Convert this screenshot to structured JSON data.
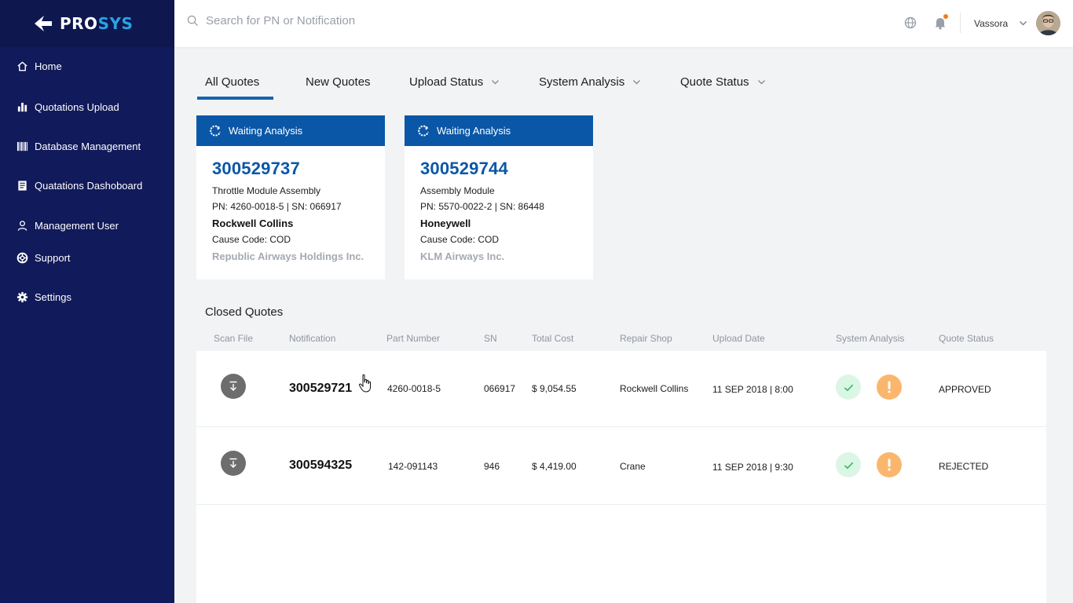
{
  "brand": {
    "name_part1": "PRO",
    "name_part2": "SYS"
  },
  "sidebar": {
    "items": [
      {
        "label": "Home",
        "icon": "home-icon"
      },
      {
        "label": "Quotations Upload",
        "icon": "bar-chart-icon"
      },
      {
        "label": "Database Management",
        "icon": "barcode-icon"
      },
      {
        "label": "Quatations Dashoboard",
        "icon": "document-icon"
      },
      {
        "label": "Management User",
        "icon": "user-icon"
      },
      {
        "label": "Support",
        "icon": "lifebuoy-icon"
      },
      {
        "label": "Settings",
        "icon": "gear-icon"
      }
    ]
  },
  "header": {
    "search_placeholder": "Search for PN or Notification",
    "username": "Vassora"
  },
  "tabs": [
    {
      "label": "All Quotes",
      "active": true
    },
    {
      "label": "New Quotes"
    },
    {
      "label": "Upload Status",
      "dropdown": true
    },
    {
      "label": "System Analysis",
      "dropdown": true
    },
    {
      "label": "Quote Status",
      "dropdown": true
    }
  ],
  "cards": [
    {
      "status": "Waiting Analysis",
      "number": "300529737",
      "description": "Throttle Module Assembly",
      "pn_sn": "PN: 4260-0018-5 | SN: 066917",
      "shop": "Rockwell Collins",
      "cause": "Cause Code: COD",
      "customer": "Republic Airways Holdings Inc."
    },
    {
      "status": "Waiting Analysis",
      "number": "300529744",
      "description": "Assembly Module",
      "pn_sn": "PN: 5570-0022-2 | SN: 86448",
      "shop": "Honeywell",
      "cause": "Cause Code: COD",
      "customer": "KLM Airways Inc."
    }
  ],
  "closed": {
    "title": "Closed Quotes",
    "columns": [
      "Scan File",
      "Notification",
      "Part Number",
      "SN",
      "Total Cost",
      "Repair Shop",
      "Upload Date",
      "System Analysis",
      "Quote Status"
    ],
    "rows": [
      {
        "notification": "300529721",
        "part_number": "4260-0018-5",
        "sn": "066917",
        "total_cost": "$ 9,054.55",
        "repair_shop": "Rockwell Collins",
        "upload_date": "11 SEP 2018 | 8:00",
        "quote_status": "APPROVED"
      },
      {
        "notification": "300594325",
        "part_number": "142-091143",
        "sn": "946",
        "total_cost": "$ 4,419.00",
        "repair_shop": "Crane",
        "upload_date": "11 SEP 2018 | 9:30",
        "quote_status": "REJECTED"
      }
    ]
  },
  "colors": {
    "sidebar": "#111a5a",
    "accent": "#0a57a7",
    "success_bg": "#dcf6e6",
    "warning_bg": "#fbb66e"
  }
}
